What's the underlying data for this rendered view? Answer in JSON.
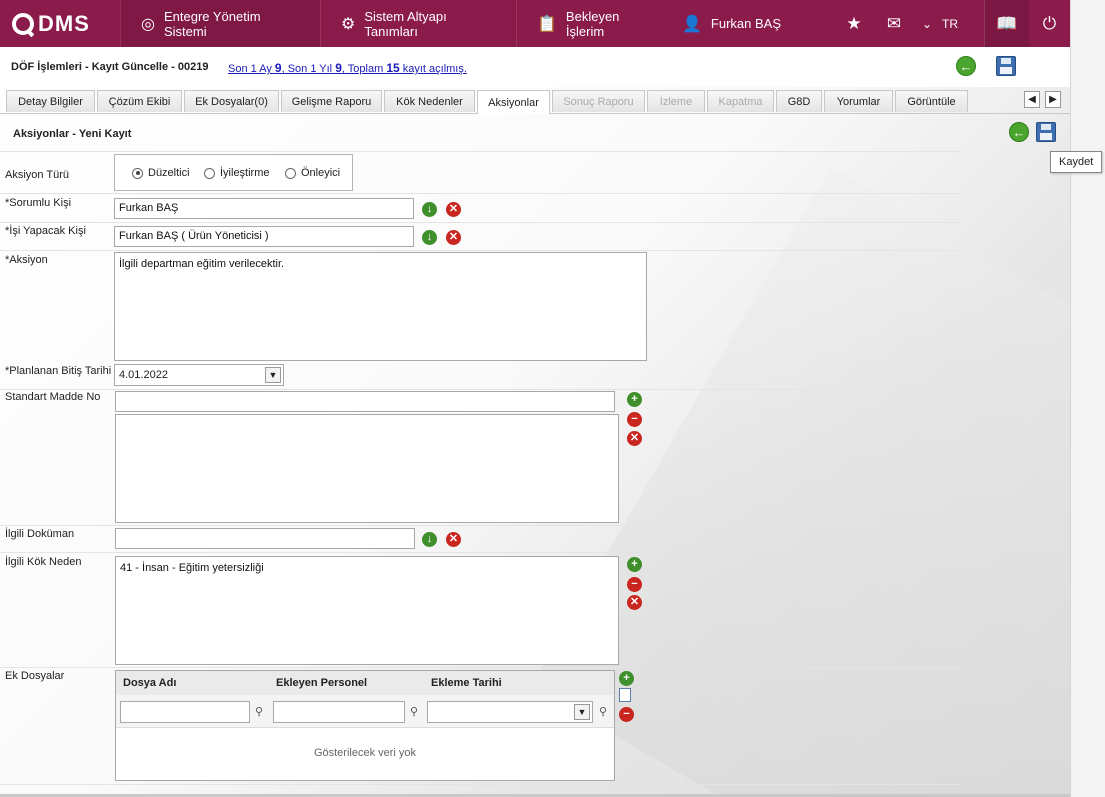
{
  "topbar": {
    "logo": "DMS",
    "nav": [
      {
        "label": "Entegre Yönetim Sistemi",
        "icon": "q-logo-icon"
      },
      {
        "label": "Sistem Altyapı Tanımları",
        "icon": "gear-icon"
      },
      {
        "label": "Bekleyen İşlerim",
        "icon": "clipboard-icon"
      },
      {
        "label": "Furkan BAŞ",
        "icon": "user-icon"
      }
    ],
    "lang": "TR",
    "accent_color": "#8a1b4b"
  },
  "header": {
    "title": "DÖF İşlemleri - Kayıt Güncelle - 00219",
    "records_pre": "Son 1 Ay ",
    "records_month": "9",
    "records_mid1": ", Son 1 Yıl ",
    "records_year": "9",
    "records_mid2": ", Toplam ",
    "records_total": "15",
    "records_post": " kayıt açılmış."
  },
  "tabs": [
    {
      "label": "Detay Bilgiler",
      "state": "normal"
    },
    {
      "label": "Çözüm Ekibi",
      "state": "normal"
    },
    {
      "label": "Ek Dosyalar(0)",
      "state": "normal"
    },
    {
      "label": "Gelişme Raporu",
      "state": "normal"
    },
    {
      "label": "Kök Nedenler",
      "state": "normal"
    },
    {
      "label": "Aksiyonlar",
      "state": "active"
    },
    {
      "label": "Sonuç Raporu",
      "state": "disabled"
    },
    {
      "label": "İzleme",
      "state": "disabled"
    },
    {
      "label": "Kapatma",
      "state": "disabled"
    },
    {
      "label": "G8D",
      "state": "normal"
    },
    {
      "label": "Yorumlar",
      "state": "normal"
    },
    {
      "label": "Görüntüle",
      "state": "normal"
    }
  ],
  "section": {
    "title": "Aksiyonlar - Yeni Kayıt",
    "tooltip": "Kaydet"
  },
  "form": {
    "aksiyon_turu": {
      "label": "Aksiyon Türü",
      "options": [
        "Düzeltici",
        "İyileştirme",
        "Önleyici"
      ],
      "selected": "Düzeltici"
    },
    "sorumlu": {
      "label": "*Sorumlu Kişi",
      "value": "Furkan BAŞ"
    },
    "isi_yapacak": {
      "label": "*İşi Yapacak Kişi",
      "value": "Furkan BAŞ ( Ürün Yöneticisi )"
    },
    "aksiyon": {
      "label": "*Aksiyon",
      "value": "İlgili departman eğitim verilecektir."
    },
    "bitis": {
      "label": "*Planlanan Bitiş Tarihi",
      "value": "4.01.2022"
    },
    "standart_madde": {
      "label": "Standart Madde No",
      "value": ""
    },
    "ilgili_dokuman": {
      "label": "İlgili Doküman",
      "value": ""
    },
    "kok_neden": {
      "label": "İlgili Kök Neden",
      "value": "41 - İnsan - Eğitim yetersizliği"
    },
    "ek_dosyalar": {
      "label": "Ek Dosyalar",
      "columns": [
        "Dosya Adı",
        "Ekleyen Personel",
        "Ekleme Tarihi"
      ],
      "empty_text": "Gösterilecek veri yok"
    }
  }
}
